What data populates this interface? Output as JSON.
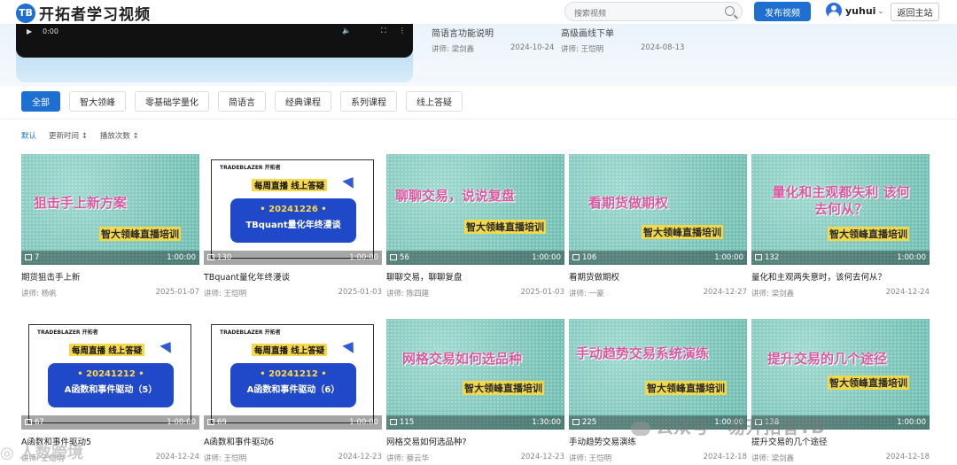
{
  "header": {
    "logo_mark": "TB",
    "logo_text": "开拓者学习视频",
    "search_placeholder": "搜索视频",
    "publish_label": "发布视频",
    "username": "yuhui",
    "back_label": "返回主站"
  },
  "banner": {
    "player_time": "0:00",
    "video1_title": "简语言功能说明",
    "video1_author": "讲师: 梁剑鑫",
    "video1_date": "2024-10-24",
    "video2_title": "高级画线下单",
    "video2_author": "讲师: 王恺明",
    "video2_date": "2024-08-13"
  },
  "tabs": [
    "全部",
    "智大领峰",
    "零基础学量化",
    "简语言",
    "经典课程",
    "系列课程",
    "线上答疑"
  ],
  "sorts": [
    "默认",
    "更新时间 ↕",
    "播放次数 ↕"
  ],
  "videos": [
    {
      "thumb_title": "狙击手上新方案",
      "thumb_sub": "智大领峰直播培训",
      "views": "7",
      "duration": "1:00:00",
      "title": "期货狙击手上新",
      "author": "讲师: 杨帆",
      "date": "2025-01-07"
    },
    {
      "poster_brand": "TRADEBLAZER 开拓者",
      "poster_tag": "每周直播 线上答疑",
      "poster_date": "• 20241226 •",
      "poster_topic": "TBquant量化年终漫谈",
      "views": "130",
      "duration": "1:00:00",
      "title": "TBquant量化年终漫谈",
      "author": "讲师: 王恺明",
      "date": "2025-01-03"
    },
    {
      "thumb_title": "聊聊交易，说说复盘",
      "thumb_sub": "智大领峰直播培训",
      "views": "56",
      "duration": "1:00:00",
      "title": "聊聊交易，聊聊复盘",
      "author": "讲师: 陈四建",
      "date": "2025-01-03"
    },
    {
      "thumb_title": "看期货做期权",
      "thumb_sub": "智大领峰直播培训",
      "views": "106",
      "duration": "1:00:00",
      "title": "看期货做期权",
      "author": "讲师: 一豪",
      "date": "2024-12-27"
    },
    {
      "thumb_title": "量化和主观都失利 该何去何从？",
      "thumb_sub": "智大领峰直播培训",
      "views": "132",
      "duration": "1:00:00",
      "title": "量化和主观两失意时，该何去何从？",
      "author": "讲师: 梁剑鑫",
      "date": "2024-12-24"
    },
    {
      "poster_brand": "TRADEBLAZER 开拓者",
      "poster_tag": "每周直播 线上答疑",
      "poster_date": "• 20241212 •",
      "poster_topic": "A函数和事件驱动（5）",
      "views": "67",
      "duration": "1:00:00",
      "title": "A函数和事件驱动5",
      "author": "讲师: 王恺明",
      "date": "2024-12-24"
    },
    {
      "poster_brand": "TRADEBLAZER 开拓者",
      "poster_tag": "每周直播 线上答疑",
      "poster_date": "• 20241212 •",
      "poster_topic": "A函数和事件驱动（6）",
      "views": "69",
      "duration": "1:00:00",
      "title": "A函数和事件驱动6",
      "author": "讲师: 王恺明",
      "date": "2024-12-23"
    },
    {
      "thumb_title": "网格交易如何选品种",
      "thumb_sub": "智大领峰直播培训",
      "views": "115",
      "duration": "1:30:00",
      "title": "网格交易如何选品种?",
      "author": "讲师: 蔡云华",
      "date": "2024-12-23"
    },
    {
      "thumb_title": "手动趋势交易系统演练",
      "thumb_sub": "智大领峰直播培训",
      "views": "225",
      "duration": "1:00:00",
      "title": "手动趋势交易演练",
      "author": "讲师: 王恺明",
      "date": "2024-12-18"
    },
    {
      "thumb_title": "提升交易的几个途径",
      "thumb_sub": "智大领峰直播培训",
      "views": "138",
      "duration": "1:00:00",
      "title": "提升交易的几个途径",
      "author": "讲师: 梁剑鑫",
      "date": "2024-12-18"
    }
  ],
  "watermark": "公众号 · 易开拓者TB",
  "watermark2": "◎ 人数跨境"
}
